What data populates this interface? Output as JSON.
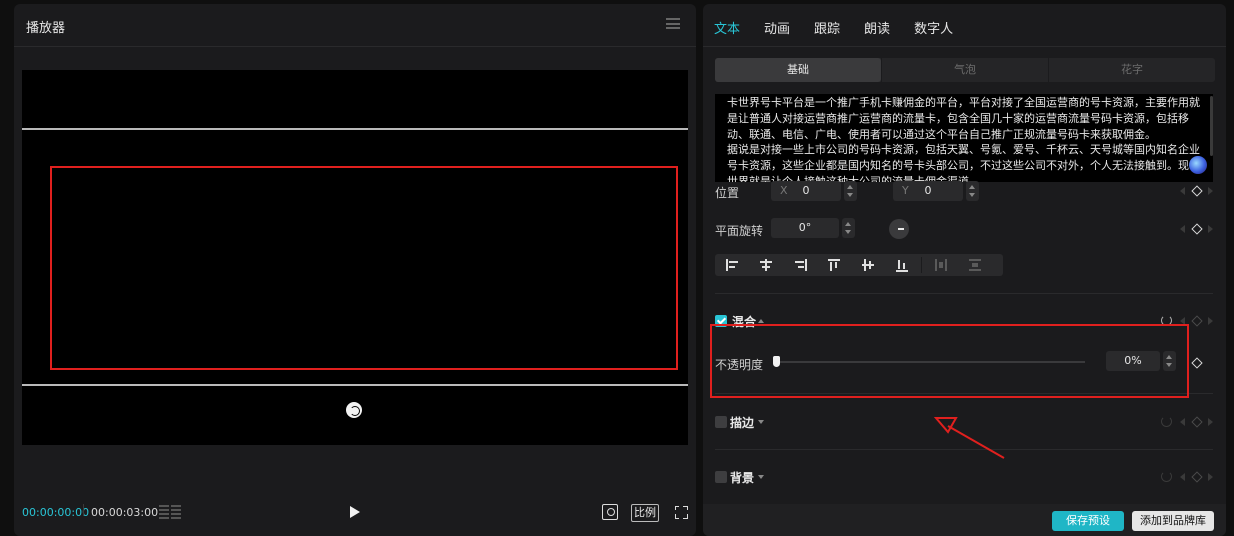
{
  "player": {
    "title": "播放器",
    "timecode_current": "00:00:00:00",
    "timecode_total": "00:00:03:00",
    "ratio_label": "比例"
  },
  "inspector": {
    "tabs": [
      "文本",
      "动画",
      "跟踪",
      "朗读",
      "数字人"
    ],
    "active_tab": "文本",
    "subtabs": [
      "基础",
      "气泡",
      "花字"
    ],
    "active_subtab": "基础",
    "text_content": "卡世界号卡平台是一个推广手机卡赚佣金的平台，平台对接了全国运营商的号卡资源，主要作用就是让普通人对接运营商推广运营商的流量卡，包含全国几十家的运营商流量号码卡资源，包括移动、联通、电信、广电、使用者可以通过这个平台自己推广正规流量号码卡来获取佣金。\n据说是对接一些上市公司的号码卡资源，包括天翼、号氪、爱号、千杯云、天号城等国内知名企业号卡资源，这些企业都是国内知名的号卡头部公司，不过这些公司不对外，个人无法接触到。现卡世界就是让个人接触这种大公司的流量卡佣金渠道",
    "position": {
      "label": "位置",
      "x_axis": "X",
      "x_value": "0",
      "y_axis": "Y",
      "y_value": "0"
    },
    "rotation": {
      "label": "平面旋转",
      "value": "0°"
    },
    "blend": {
      "label": "混合",
      "checked": true
    },
    "opacity": {
      "label": "不透明度",
      "value": "0%",
      "level": 0
    },
    "stroke": {
      "label": "描边",
      "checked": false
    },
    "background": {
      "label": "背景",
      "checked": false
    },
    "save_preset": "保存预设",
    "add_to_brand": "添加到品牌库"
  },
  "colors": {
    "accent": "#29c5d6",
    "annotation_red": "#e0201e",
    "panel_bg": "#1b1b1d"
  }
}
